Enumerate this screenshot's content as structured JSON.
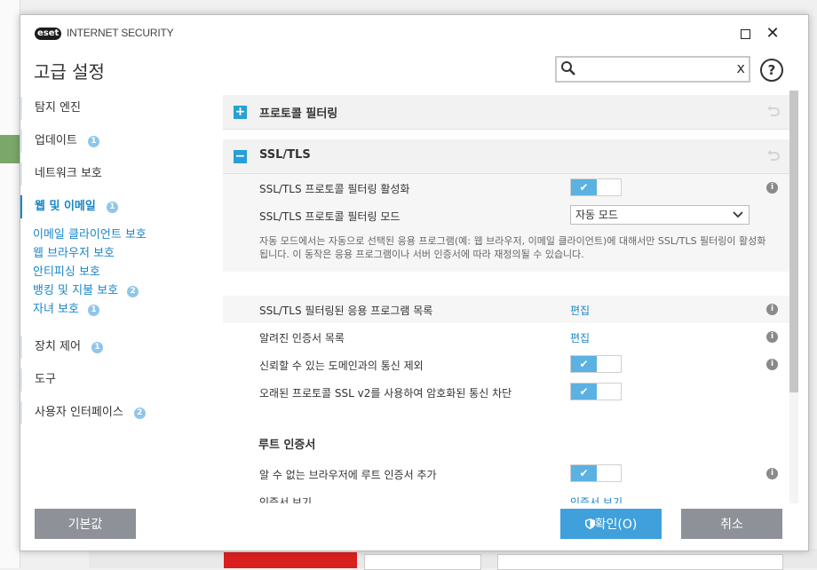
{
  "window": {
    "logo": "eset",
    "product": "INTERNET SECURITY",
    "maximize_icon": "maximize-icon",
    "close_glyph": "✕"
  },
  "header": {
    "title": "고급 설정",
    "search_placeholder": "",
    "search_value": "",
    "clear_glyph": "x",
    "help_glyph": "?"
  },
  "sidebar": {
    "items": [
      {
        "label": "탐지 엔진"
      },
      {
        "label": "업데이트",
        "badge": "1"
      },
      {
        "label": "네트워크 보호"
      },
      {
        "label": "웹 및 이메일",
        "badge": "1"
      },
      {
        "label": "장치 제어",
        "badge": "1"
      },
      {
        "label": "도구"
      },
      {
        "label": "사용자 인터페이스",
        "badge": "2"
      }
    ],
    "subitems": [
      {
        "label": "이메일 클라이언트 보호"
      },
      {
        "label": "웹 브라우저 보호"
      },
      {
        "label": "안티피싱 보호"
      },
      {
        "label": "뱅킹 및 지불 보호",
        "badge": "2"
      },
      {
        "label": "자녀 보호",
        "badge": "1"
      }
    ]
  },
  "sections": {
    "protocol_filtering": {
      "label": "프로토콜 필터링",
      "expand": "+"
    },
    "ssl": {
      "label": "SSL/TLS",
      "collapse": "−"
    }
  },
  "settings": {
    "enable_filtering": "SSL/TLS 프로토콜 필터링 활성화",
    "filtering_mode": "SSL/TLS 프로토콜 필터링 모드",
    "mode_value": "자동 모드",
    "mode_description": "자동 모드에서는 자동으로 선택된 응용 프로그램(예: 웹 브라우저, 이메일 클라이언트)에 대해서만 SSL/TLS 필터링이 활성화됩니다. 이 동작은 응용 프로그램이나 서버 인증서에 따라 재정의될 수 있습니다.",
    "app_list": "SSL/TLS 필터링된 응용 프로그램 목록",
    "cert_list": "알려진 인증서 목록",
    "trusted_domain": "신뢰할 수 있는 도메인과의 통신 제외",
    "block_sslv2": "오래된 프로토콜 SSL v2를 사용하여 암호화된 통신 차단",
    "root_cert_heading": "루트 인증서",
    "add_root_cert": "알 수 없는 브라우저에 루트 인증서 추가",
    "view_cert": "인증서 보기",
    "edit_link": "편집",
    "view_cert_link": "인증서 보기",
    "check_glyph": "✔",
    "info_glyph": "i"
  },
  "toggles": {
    "enable_filtering": true,
    "trusted_domain": true,
    "block_sslv2": true,
    "add_root_cert": true
  },
  "footer": {
    "default_label": "기본값",
    "ok_label": "확인(O)",
    "cancel_label": "취소"
  },
  "colors": {
    "accent": "#1a86c8",
    "toggle_on": "#5bb1e2",
    "button_gray": "#8e9197",
    "button_blue": "#3fa0db"
  }
}
